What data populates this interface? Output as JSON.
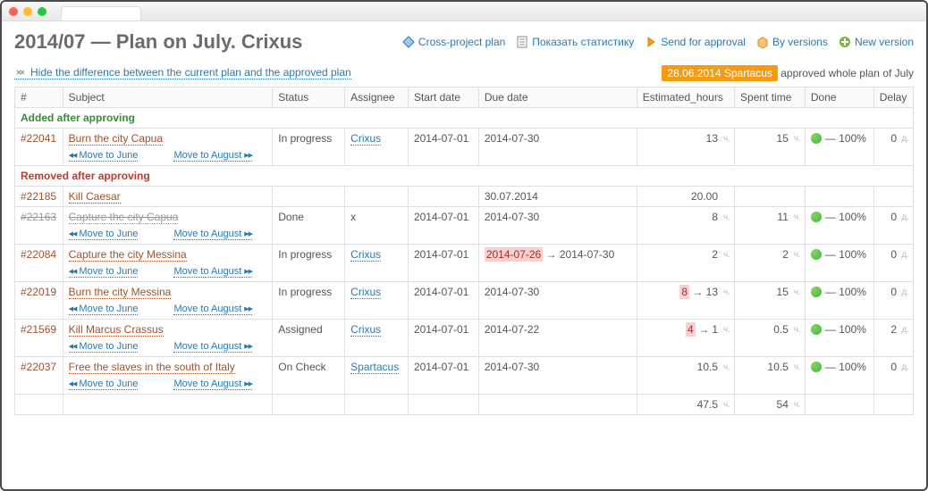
{
  "page_title": "2014/07 — Plan on July. Crixus",
  "header_links": {
    "cross_project": "Cross-project plan",
    "show_stats": "Показать статистику",
    "send_approval": "Send for approval",
    "by_versions": "By versions",
    "new_version": "New version"
  },
  "hide_diff": "Hide the difference between the current plan and the approved plan",
  "approval": {
    "stamp": "28.06.2014 Spartacus",
    "text": "approved whole plan of July"
  },
  "columns": {
    "id": "#",
    "subject": "Subject",
    "status": "Status",
    "assignee": "Assignee",
    "start": "Start date",
    "due": "Due date",
    "est": "Estimated_hours",
    "spent": "Spent time",
    "done": "Done",
    "delay": "Delay"
  },
  "sections": {
    "added": "Added after approving",
    "removed": "Removed after approving"
  },
  "move": {
    "prev": "Move to June",
    "next": "Move to August"
  },
  "units": {
    "h": "ч.",
    "d": "д."
  },
  "rows": [
    {
      "id": "#22041",
      "subject": "Burn the city Capua",
      "status": "In progress",
      "assignee": "Crixus",
      "start": "2014-07-01",
      "due": "2014-07-30",
      "est": "13",
      "spent": "15",
      "done": "— 100%",
      "delay": "0",
      "move": true
    },
    {
      "id": "#22185",
      "subject": "Kill Caesar",
      "status": "",
      "assignee": "",
      "start": "",
      "due": "30.07.2014",
      "est": "20.00",
      "spent": "",
      "done": "",
      "delay": "",
      "move": false
    },
    {
      "id": "#22163",
      "subject": "Capture the city Capua",
      "status": "Done",
      "assignee": "x",
      "start": "2014-07-01",
      "due": "2014-07-30",
      "est": "8",
      "spent": "11",
      "done": "— 100%",
      "delay": "0",
      "move": true,
      "strike": true
    },
    {
      "id": "#22084",
      "subject": "Capture the city Messina",
      "status": "In progress",
      "assignee": "Crixus",
      "start": "2014-07-01",
      "due_old": "2014-07-26",
      "due_new": "2014-07-30",
      "est": "2",
      "spent": "2",
      "done": "— 100%",
      "delay": "0",
      "move": true
    },
    {
      "id": "#22019",
      "subject": "Burn the city Messina",
      "status": "In progress",
      "assignee": "Crixus",
      "start": "2014-07-01",
      "due": "2014-07-30",
      "est_old": "8",
      "est_new": "13",
      "spent": "15",
      "done": "— 100%",
      "delay": "0",
      "move": true
    },
    {
      "id": "#21569",
      "subject": "Kill Marcus Crassus",
      "status": "Assigned",
      "assignee": "Crixus",
      "start": "2014-07-01",
      "due": "2014-07-22",
      "est_old": "4",
      "est_new": "1",
      "spent": "0.5",
      "done": "— 100%",
      "delay": "2",
      "move": true
    },
    {
      "id": "#22037",
      "subject": "Free the slaves in the south of Italy",
      "status": "On Check",
      "assignee": "Spartacus",
      "start": "2014-07-01",
      "due": "2014-07-30",
      "est": "10.5",
      "spent": "10.5",
      "done": "— 100%",
      "delay": "0",
      "move": true
    }
  ],
  "totals": {
    "est": "47.5",
    "spent": "54"
  }
}
